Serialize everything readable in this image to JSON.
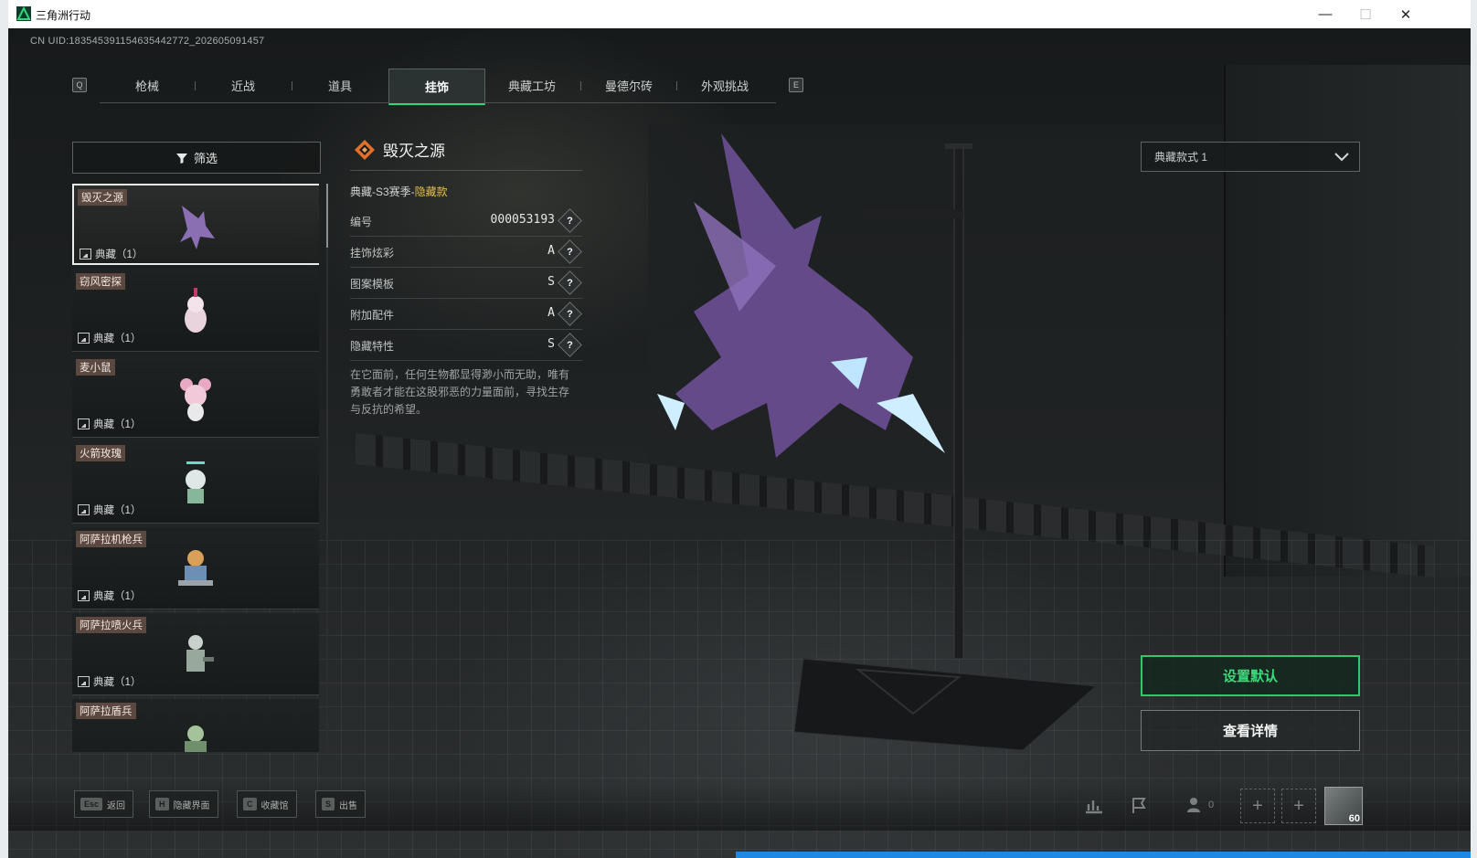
{
  "window": {
    "title": "三角洲行动"
  },
  "uid_text": "CN UID:183545391154635442772_202605091457",
  "tabs": {
    "left_key": "Q",
    "right_key": "E",
    "items": [
      "枪械",
      "近战",
      "道具",
      "挂饰",
      "典藏工坊",
      "曼德尔砖",
      "外观挑战"
    ],
    "active": "挂饰"
  },
  "filter": {
    "label": "筛选"
  },
  "items": [
    {
      "name": "毁灭之源",
      "count": "典藏（1）"
    },
    {
      "name": "窃风密探",
      "count": "典藏（1）"
    },
    {
      "name": "麦小鼠",
      "count": "典藏（1）"
    },
    {
      "name": "火箭玫瑰",
      "count": "典藏（1）"
    },
    {
      "name": "阿萨拉机枪兵",
      "count": "典藏（1）"
    },
    {
      "name": "阿萨拉喷火兵",
      "count": "典藏（1）"
    },
    {
      "name": "阿萨拉盾兵",
      "count": ""
    }
  ],
  "detail": {
    "title": "毁灭之源",
    "subtitle_prefix": "典藏-S3赛季-",
    "subtitle_hidden": "隐藏款",
    "stats": [
      {
        "label": "编号",
        "value": "000053193"
      },
      {
        "label": "挂饰炫彩",
        "value": "A"
      },
      {
        "label": "图案模板",
        "value": "S"
      },
      {
        "label": "附加配件",
        "value": "A"
      },
      {
        "label": "隐藏特性",
        "value": "S"
      }
    ],
    "description": "在它面前，任何生物都显得渺小而无助，唯有勇敢者才能在这股邪恶的力量面前，寻找生存与反抗的希望。"
  },
  "style_select": {
    "value": "典藏款式 1"
  },
  "buttons": {
    "set_default": "设置默认",
    "view_details": "查看详情"
  },
  "hotkeys": [
    {
      "key": "Esc",
      "label": "返回"
    },
    {
      "key": "H",
      "label": "隐藏界面"
    },
    {
      "key": "C",
      "label": "收藏馆"
    },
    {
      "key": "S",
      "label": "出售"
    }
  ],
  "friends_count": "0",
  "player_level": "60",
  "colors": {
    "accent_green": "#35d67a",
    "hidden_gold": "#e3bd4c",
    "tag_brown": "#5b4841"
  }
}
